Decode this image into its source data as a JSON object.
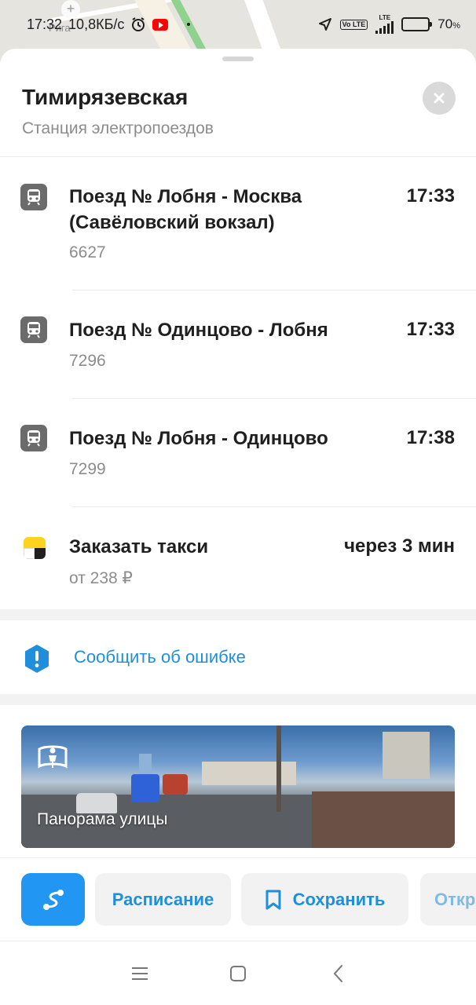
{
  "status_bar": {
    "time": "17:32",
    "net_speed": "10,8КБ/с",
    "network_type": "LTE",
    "volte": "Vo LTE",
    "battery_value": "70",
    "battery_unit": "%",
    "battery_level": 0.7
  },
  "map": {
    "place_label": "Рига"
  },
  "station": {
    "name": "Тимирязевская",
    "type": "Станция электропоездов"
  },
  "trains": [
    {
      "title": "Поезд № Лобня - Москва (Савёловский вокзал)",
      "number": "6627",
      "time": "17:33"
    },
    {
      "title": "Поезд № Одинцово - Лобня",
      "number": "7296",
      "time": "17:33"
    },
    {
      "title": "Поезд № Лобня - Одинцово",
      "number": "7299",
      "time": "17:38"
    }
  ],
  "taxi": {
    "title": "Заказать такси",
    "price": "от 238 ₽",
    "eta": "через 3 мин"
  },
  "report": {
    "label": "Сообщить об ошибке"
  },
  "panorama": {
    "label": "Панорама улицы"
  },
  "actions": {
    "schedule": "Расписание",
    "save": "Сохранить",
    "open": "Откр"
  },
  "colors": {
    "accent": "#2196f3",
    "link": "#1f8fdc",
    "taxi_yellow": "#ffd21f"
  }
}
